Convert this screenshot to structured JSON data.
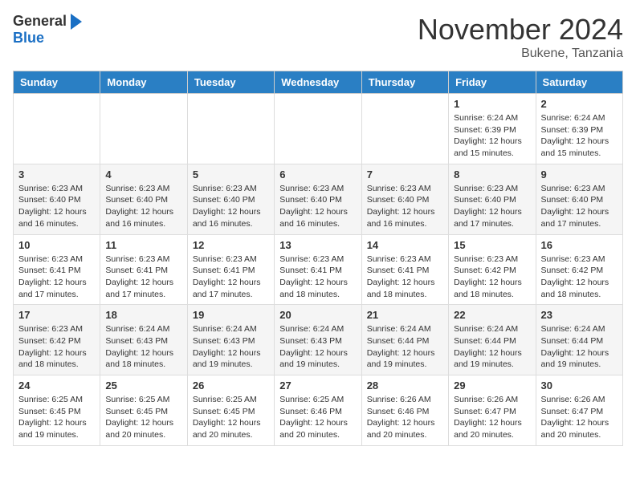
{
  "logo": {
    "general": "General",
    "blue": "Blue"
  },
  "title": "November 2024",
  "location": "Bukene, Tanzania",
  "days_of_week": [
    "Sunday",
    "Monday",
    "Tuesday",
    "Wednesday",
    "Thursday",
    "Friday",
    "Saturday"
  ],
  "weeks": [
    [
      {
        "day": "",
        "info": ""
      },
      {
        "day": "",
        "info": ""
      },
      {
        "day": "",
        "info": ""
      },
      {
        "day": "",
        "info": ""
      },
      {
        "day": "",
        "info": ""
      },
      {
        "day": "1",
        "info": "Sunrise: 6:24 AM\nSunset: 6:39 PM\nDaylight: 12 hours and 15 minutes."
      },
      {
        "day": "2",
        "info": "Sunrise: 6:24 AM\nSunset: 6:39 PM\nDaylight: 12 hours and 15 minutes."
      }
    ],
    [
      {
        "day": "3",
        "info": "Sunrise: 6:23 AM\nSunset: 6:40 PM\nDaylight: 12 hours and 16 minutes."
      },
      {
        "day": "4",
        "info": "Sunrise: 6:23 AM\nSunset: 6:40 PM\nDaylight: 12 hours and 16 minutes."
      },
      {
        "day": "5",
        "info": "Sunrise: 6:23 AM\nSunset: 6:40 PM\nDaylight: 12 hours and 16 minutes."
      },
      {
        "day": "6",
        "info": "Sunrise: 6:23 AM\nSunset: 6:40 PM\nDaylight: 12 hours and 16 minutes."
      },
      {
        "day": "7",
        "info": "Sunrise: 6:23 AM\nSunset: 6:40 PM\nDaylight: 12 hours and 16 minutes."
      },
      {
        "day": "8",
        "info": "Sunrise: 6:23 AM\nSunset: 6:40 PM\nDaylight: 12 hours and 17 minutes."
      },
      {
        "day": "9",
        "info": "Sunrise: 6:23 AM\nSunset: 6:40 PM\nDaylight: 12 hours and 17 minutes."
      }
    ],
    [
      {
        "day": "10",
        "info": "Sunrise: 6:23 AM\nSunset: 6:41 PM\nDaylight: 12 hours and 17 minutes."
      },
      {
        "day": "11",
        "info": "Sunrise: 6:23 AM\nSunset: 6:41 PM\nDaylight: 12 hours and 17 minutes."
      },
      {
        "day": "12",
        "info": "Sunrise: 6:23 AM\nSunset: 6:41 PM\nDaylight: 12 hours and 17 minutes."
      },
      {
        "day": "13",
        "info": "Sunrise: 6:23 AM\nSunset: 6:41 PM\nDaylight: 12 hours and 18 minutes."
      },
      {
        "day": "14",
        "info": "Sunrise: 6:23 AM\nSunset: 6:41 PM\nDaylight: 12 hours and 18 minutes."
      },
      {
        "day": "15",
        "info": "Sunrise: 6:23 AM\nSunset: 6:42 PM\nDaylight: 12 hours and 18 minutes."
      },
      {
        "day": "16",
        "info": "Sunrise: 6:23 AM\nSunset: 6:42 PM\nDaylight: 12 hours and 18 minutes."
      }
    ],
    [
      {
        "day": "17",
        "info": "Sunrise: 6:23 AM\nSunset: 6:42 PM\nDaylight: 12 hours and 18 minutes."
      },
      {
        "day": "18",
        "info": "Sunrise: 6:24 AM\nSunset: 6:43 PM\nDaylight: 12 hours and 18 minutes."
      },
      {
        "day": "19",
        "info": "Sunrise: 6:24 AM\nSunset: 6:43 PM\nDaylight: 12 hours and 19 minutes."
      },
      {
        "day": "20",
        "info": "Sunrise: 6:24 AM\nSunset: 6:43 PM\nDaylight: 12 hours and 19 minutes."
      },
      {
        "day": "21",
        "info": "Sunrise: 6:24 AM\nSunset: 6:44 PM\nDaylight: 12 hours and 19 minutes."
      },
      {
        "day": "22",
        "info": "Sunrise: 6:24 AM\nSunset: 6:44 PM\nDaylight: 12 hours and 19 minutes."
      },
      {
        "day": "23",
        "info": "Sunrise: 6:24 AM\nSunset: 6:44 PM\nDaylight: 12 hours and 19 minutes."
      }
    ],
    [
      {
        "day": "24",
        "info": "Sunrise: 6:25 AM\nSunset: 6:45 PM\nDaylight: 12 hours and 19 minutes."
      },
      {
        "day": "25",
        "info": "Sunrise: 6:25 AM\nSunset: 6:45 PM\nDaylight: 12 hours and 20 minutes."
      },
      {
        "day": "26",
        "info": "Sunrise: 6:25 AM\nSunset: 6:45 PM\nDaylight: 12 hours and 20 minutes."
      },
      {
        "day": "27",
        "info": "Sunrise: 6:25 AM\nSunset: 6:46 PM\nDaylight: 12 hours and 20 minutes."
      },
      {
        "day": "28",
        "info": "Sunrise: 6:26 AM\nSunset: 6:46 PM\nDaylight: 12 hours and 20 minutes."
      },
      {
        "day": "29",
        "info": "Sunrise: 6:26 AM\nSunset: 6:47 PM\nDaylight: 12 hours and 20 minutes."
      },
      {
        "day": "30",
        "info": "Sunrise: 6:26 AM\nSunset: 6:47 PM\nDaylight: 12 hours and 20 minutes."
      }
    ]
  ]
}
